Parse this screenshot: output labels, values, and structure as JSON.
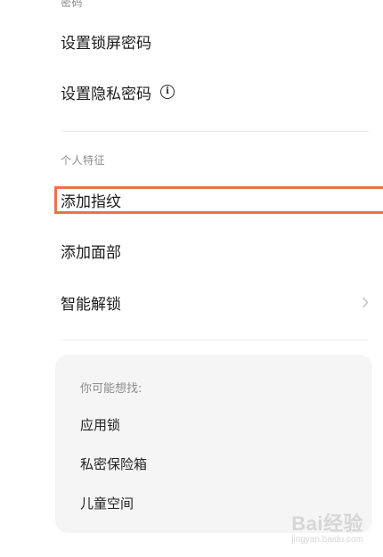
{
  "sections": {
    "password_header": "密码",
    "personal_header": "个人特征"
  },
  "password_items": [
    {
      "label": "设置锁屏密码"
    },
    {
      "label": "设置隐私密码"
    }
  ],
  "personal_items": [
    {
      "label": "添加指纹"
    },
    {
      "label": "添加面部"
    },
    {
      "label": "智能解锁"
    }
  ],
  "suggestions": {
    "title": "你可能想找:",
    "items": [
      "应用锁",
      "私密保险箱",
      "儿童空间"
    ]
  },
  "highlight_color": "#e8744a",
  "watermark": {
    "brand": "Bai经验",
    "url": "jingyan.baidu.com"
  }
}
